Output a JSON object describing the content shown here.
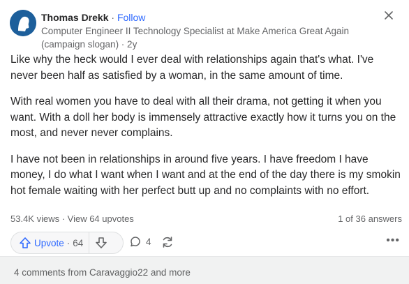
{
  "author": {
    "name": "Thomas Drekk",
    "separator": "·",
    "follow_label": "Follow",
    "credential": "Computer Engineer II Technology Specialist at Make America Great Again (campaign slogan) · 2y"
  },
  "answer": {
    "paragraphs": [
      "Like why the heck would I ever deal with relationships again that's what. I've never been half as satisfied by a woman, in the same amount of time.",
      "With real women you have to deal with all their drama, not getting it when you want. With a doll her body is immensely attractive exactly how it turns you on the most, and never never complains.",
      "I have not been in relationships in around five years. I have freedom I have money, I do what I want when I want and at the end of the day there is my smokin hot female waiting with her perfect butt up and no complaints with no effort."
    ]
  },
  "stats": {
    "views": "53.4K views · View 64 upvotes",
    "position": "1 of 36 answers"
  },
  "actions": {
    "upvote_label": "Upvote",
    "upvote_sep": "·",
    "upvote_count": "64",
    "comment_count": "4",
    "more": "•••"
  },
  "footer": {
    "comments_text": "4 comments from Caravaggio22 and more"
  },
  "icons": {
    "close": "close-icon",
    "upvote": "arrow-up-icon",
    "downvote": "arrow-down-icon",
    "comment": "comment-bubble-icon",
    "share": "share-icon",
    "more": "more-horizontal-icon"
  },
  "colors": {
    "accent": "#2e69ff",
    "text": "#282829",
    "muted": "#636466",
    "avatar_bg": "#1d5f9b",
    "footer_bg": "#f1f2f2"
  }
}
